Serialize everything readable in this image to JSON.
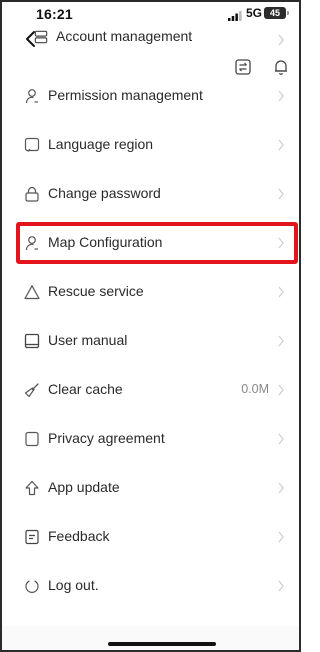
{
  "status_bar": {
    "time": "16:21",
    "network": "5G",
    "battery": "45"
  },
  "header": {
    "partial_item_label": "Account management"
  },
  "settings": {
    "items": [
      {
        "label": "Permission management",
        "icon": "person-icon"
      },
      {
        "label": "Language region",
        "icon": "language-icon"
      },
      {
        "label": "Change password",
        "icon": "lock-icon"
      },
      {
        "label": "Map Configuration",
        "icon": "person-icon"
      },
      {
        "label": "Rescue service",
        "icon": "warning-triangle-icon"
      },
      {
        "label": "User manual",
        "icon": "book-icon"
      },
      {
        "label": "Clear cache",
        "icon": "broom-icon",
        "value": "0.0M"
      },
      {
        "label": "Privacy agreement",
        "icon": "document-icon"
      },
      {
        "label": "App update",
        "icon": "upload-arrow-icon"
      },
      {
        "label": "Feedback",
        "icon": "feedback-icon"
      },
      {
        "label": "Log out.",
        "icon": "power-icon"
      }
    ]
  },
  "colors": {
    "highlight": "#e3141c",
    "text": "#2a2a2a",
    "muted": "#888888"
  }
}
